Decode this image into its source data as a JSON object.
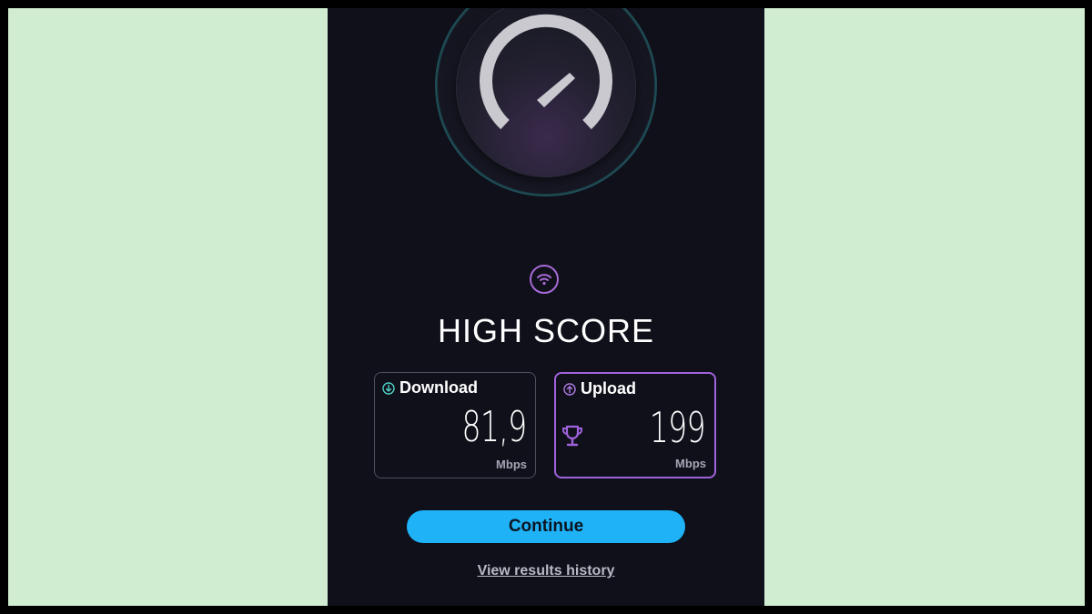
{
  "header": {
    "title": "HIGH SCORE"
  },
  "results": {
    "download": {
      "label": "Download",
      "value": "81,9",
      "unit": "Mbps"
    },
    "upload": {
      "label": "Upload",
      "value": "199",
      "unit": "Mbps",
      "high_score": true
    }
  },
  "actions": {
    "continue_label": "Continue",
    "history_link": "View results history"
  },
  "icons": {
    "speedometer": "speedometer-icon",
    "wifi": "wifi-icon",
    "download": "arrow-down-circle-icon",
    "upload": "arrow-up-circle-icon",
    "trophy": "trophy-icon"
  },
  "colors": {
    "background": "#0f101a",
    "accent_purple": "#a063dc",
    "accent_teal": "#4fd1c5",
    "button_blue": "#1fb2f7",
    "outer_frame": "#d1edd1"
  }
}
